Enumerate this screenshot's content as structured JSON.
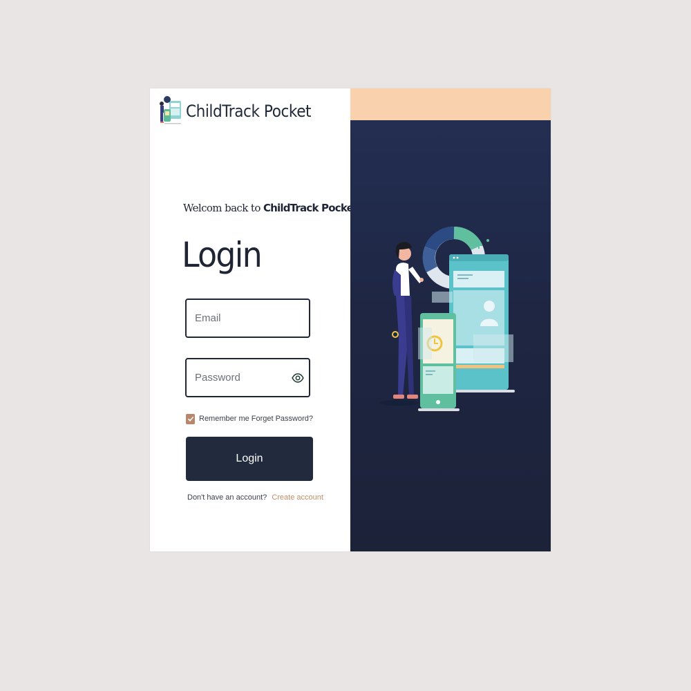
{
  "brand": {
    "name": "ChildTrack Pocket",
    "logo_icon": "logo-icon"
  },
  "welcome": {
    "prefix": "Welcom back to",
    "brand": "ChildTrack Pocket"
  },
  "title": "Login",
  "email": {
    "placeholder": "Email",
    "value": ""
  },
  "password": {
    "placeholder": "Password",
    "value": "",
    "toggle_icon": "eye-icon"
  },
  "remember": {
    "label": "Remember me",
    "checked": true
  },
  "forgot_label": "Forget Password?",
  "login_label": "Login",
  "signup": {
    "prompt": "Don't have an account?",
    "link": "Create account"
  },
  "colors": {
    "navy": "#1f2740",
    "peach": "#f9d2ad",
    "accent": "#c48c6a",
    "checkbox": "#b8876b",
    "button": "#222a3e"
  }
}
